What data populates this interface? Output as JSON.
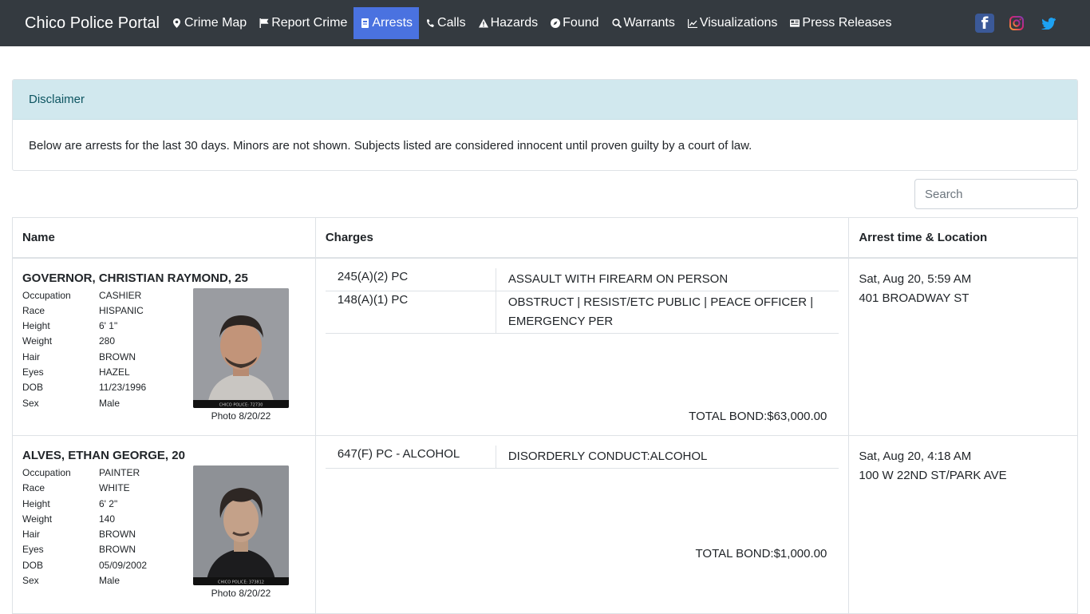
{
  "nav": {
    "brand": "Chico Police Portal",
    "items": [
      {
        "label": "Crime Map",
        "icon": "map-marker-icon",
        "active": false
      },
      {
        "label": "Report Crime",
        "icon": "flag-icon",
        "active": false
      },
      {
        "label": "Arrests",
        "icon": "badge-icon",
        "active": true
      },
      {
        "label": "Calls",
        "icon": "phone-icon",
        "active": false
      },
      {
        "label": "Hazards",
        "icon": "warning-icon",
        "active": false
      },
      {
        "label": "Found",
        "icon": "compass-icon",
        "active": false
      },
      {
        "label": "Warrants",
        "icon": "search-icon",
        "active": false
      },
      {
        "label": "Visualizations",
        "icon": "chart-icon",
        "active": false
      },
      {
        "label": "Press Releases",
        "icon": "newspaper-icon",
        "active": false
      }
    ],
    "social": [
      "facebook-icon",
      "instagram-icon",
      "twitter-icon"
    ]
  },
  "disclaimer": {
    "title": "Disclaimer",
    "text": "Below are arrests for the last 30 days. Minors are not shown. Subjects listed are considered innocent until proven guilty by a court of law."
  },
  "search": {
    "placeholder": "Search"
  },
  "table": {
    "headers": {
      "name": "Name",
      "charges": "Charges",
      "arrest": "Arrest time & Location"
    },
    "attr_labels": {
      "occupation": "Occupation",
      "race": "Race",
      "height": "Height",
      "weight": "Weight",
      "hair": "Hair",
      "eyes": "Eyes",
      "dob": "DOB",
      "sex": "Sex"
    },
    "rows": [
      {
        "name": "GOVERNOR, CHRISTIAN RAYMOND, 25",
        "occupation": "CASHIER",
        "race": "HISPANIC",
        "height": "6' 1\"",
        "weight": "280",
        "hair": "BROWN",
        "eyes": "HAZEL",
        "dob": "11/23/1996",
        "sex": "Male",
        "photo_caption": "Photo 8/20/22",
        "photo_label": "CHICO POLICE: 72730",
        "charges": [
          {
            "code": "245(A)(2) PC",
            "desc": "ASSAULT WITH FIREARM ON PERSON"
          },
          {
            "code": "148(A)(1) PC",
            "desc": "OBSTRUCT | RESIST/ETC PUBLIC | PEACE OFFICER | EMERGENCY PER"
          }
        ],
        "bond": "TOTAL BOND:$63,000.00",
        "arrest_time": "Sat, Aug 20, 5:59 AM",
        "location": "401 BROADWAY ST"
      },
      {
        "name": "ALVES, ETHAN GEORGE, 20",
        "occupation": "PAINTER",
        "race": "WHITE",
        "height": "6' 2\"",
        "weight": "140",
        "hair": "BROWN",
        "eyes": "BROWN",
        "dob": "05/09/2002",
        "sex": "Male",
        "photo_caption": "Photo 8/20/22",
        "photo_label": "CHICO POLICE: 373812",
        "charges": [
          {
            "code": "647(F) PC - ALCOHOL",
            "desc": "DISORDERLY CONDUCT:ALCOHOL"
          }
        ],
        "bond": "TOTAL BOND:$1,000.00",
        "arrest_time": "Sat, Aug 20, 4:18 AM",
        "location": "100 W 22ND ST/PARK AVE"
      }
    ]
  }
}
